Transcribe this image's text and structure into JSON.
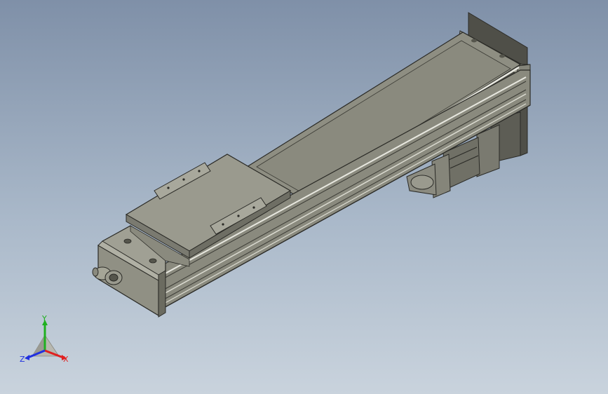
{
  "viewport": {
    "background_top": "#7f90a8",
    "background_bottom": "#c9d3dd"
  },
  "model": {
    "body_color": "#8e8e82",
    "body_light": "#a5a597",
    "body_dark": "#6b6b60",
    "edge_color": "#2a2a26",
    "highlight": "#e8e8e0",
    "motor_color": "#6e6e64"
  },
  "triad": {
    "y_label": "Y",
    "x_label": "X",
    "z_label": "Z",
    "y_color": "#1fb020",
    "x_color": "#e02020",
    "z_color": "#2030e0"
  }
}
